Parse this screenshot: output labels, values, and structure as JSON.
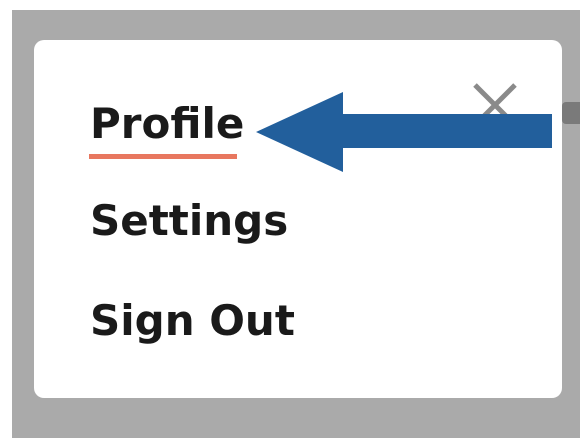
{
  "menu": {
    "items": [
      {
        "label": "Profile",
        "active": true
      },
      {
        "label": "Settings",
        "active": false
      },
      {
        "label": "Sign Out",
        "active": false
      }
    ],
    "close_icon": "close-icon"
  },
  "annotation": {
    "arrow_icon": "left-arrow-icon",
    "arrow_color": "#225f9c"
  },
  "colors": {
    "backdrop": "#aaaaaa",
    "card": "#ffffff",
    "active_underline": "#e8775f",
    "text": "#1a1a1a",
    "close_icon": "#8a8a8a"
  }
}
